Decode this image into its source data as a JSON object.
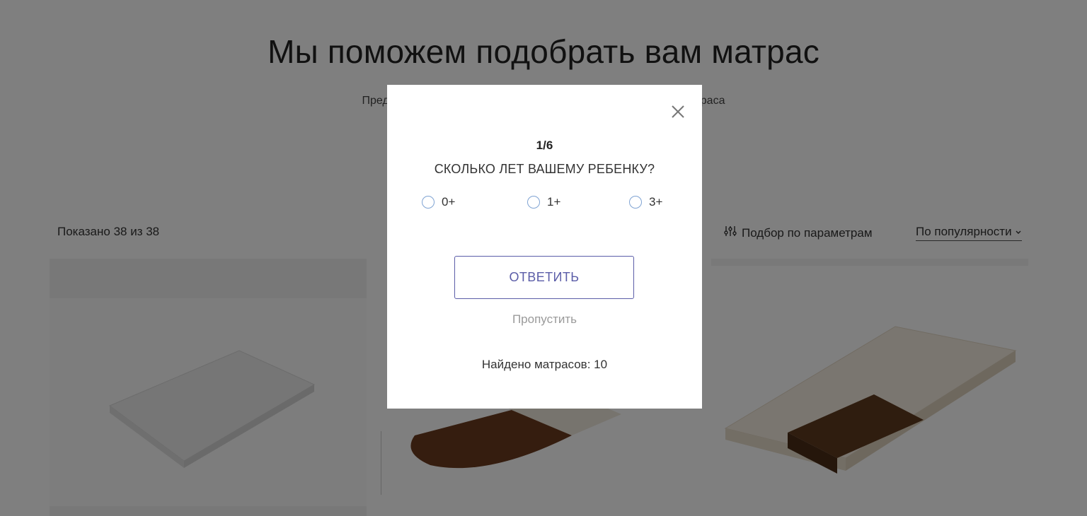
{
  "page": {
    "title": "Мы поможем подобрать вам матрас",
    "subtitle_visible_left": "Пред",
    "subtitle_visible_right": "раса",
    "shown_count": "Показано 38 из 38",
    "filter_label": "Подбор по параметрам",
    "sort_label": "По популярности",
    "icons": {
      "filter": "sliders-icon",
      "sort": "chevron-down-icon"
    }
  },
  "quiz": {
    "step": "1/6",
    "question": "СКОЛЬКО ЛЕТ ВАШЕМУ РЕБЕНКУ?",
    "options": [
      "0+",
      "1+",
      "3+"
    ],
    "answer_label": "ОТВЕТИТЬ",
    "skip_label": "Пропустить",
    "found_text": "Найдено матрасов: 10",
    "colors": {
      "accent": "#5b5da8",
      "radio_border": "#7fa3d3",
      "overlay": "rgba(0,0,0,0.5)"
    }
  }
}
